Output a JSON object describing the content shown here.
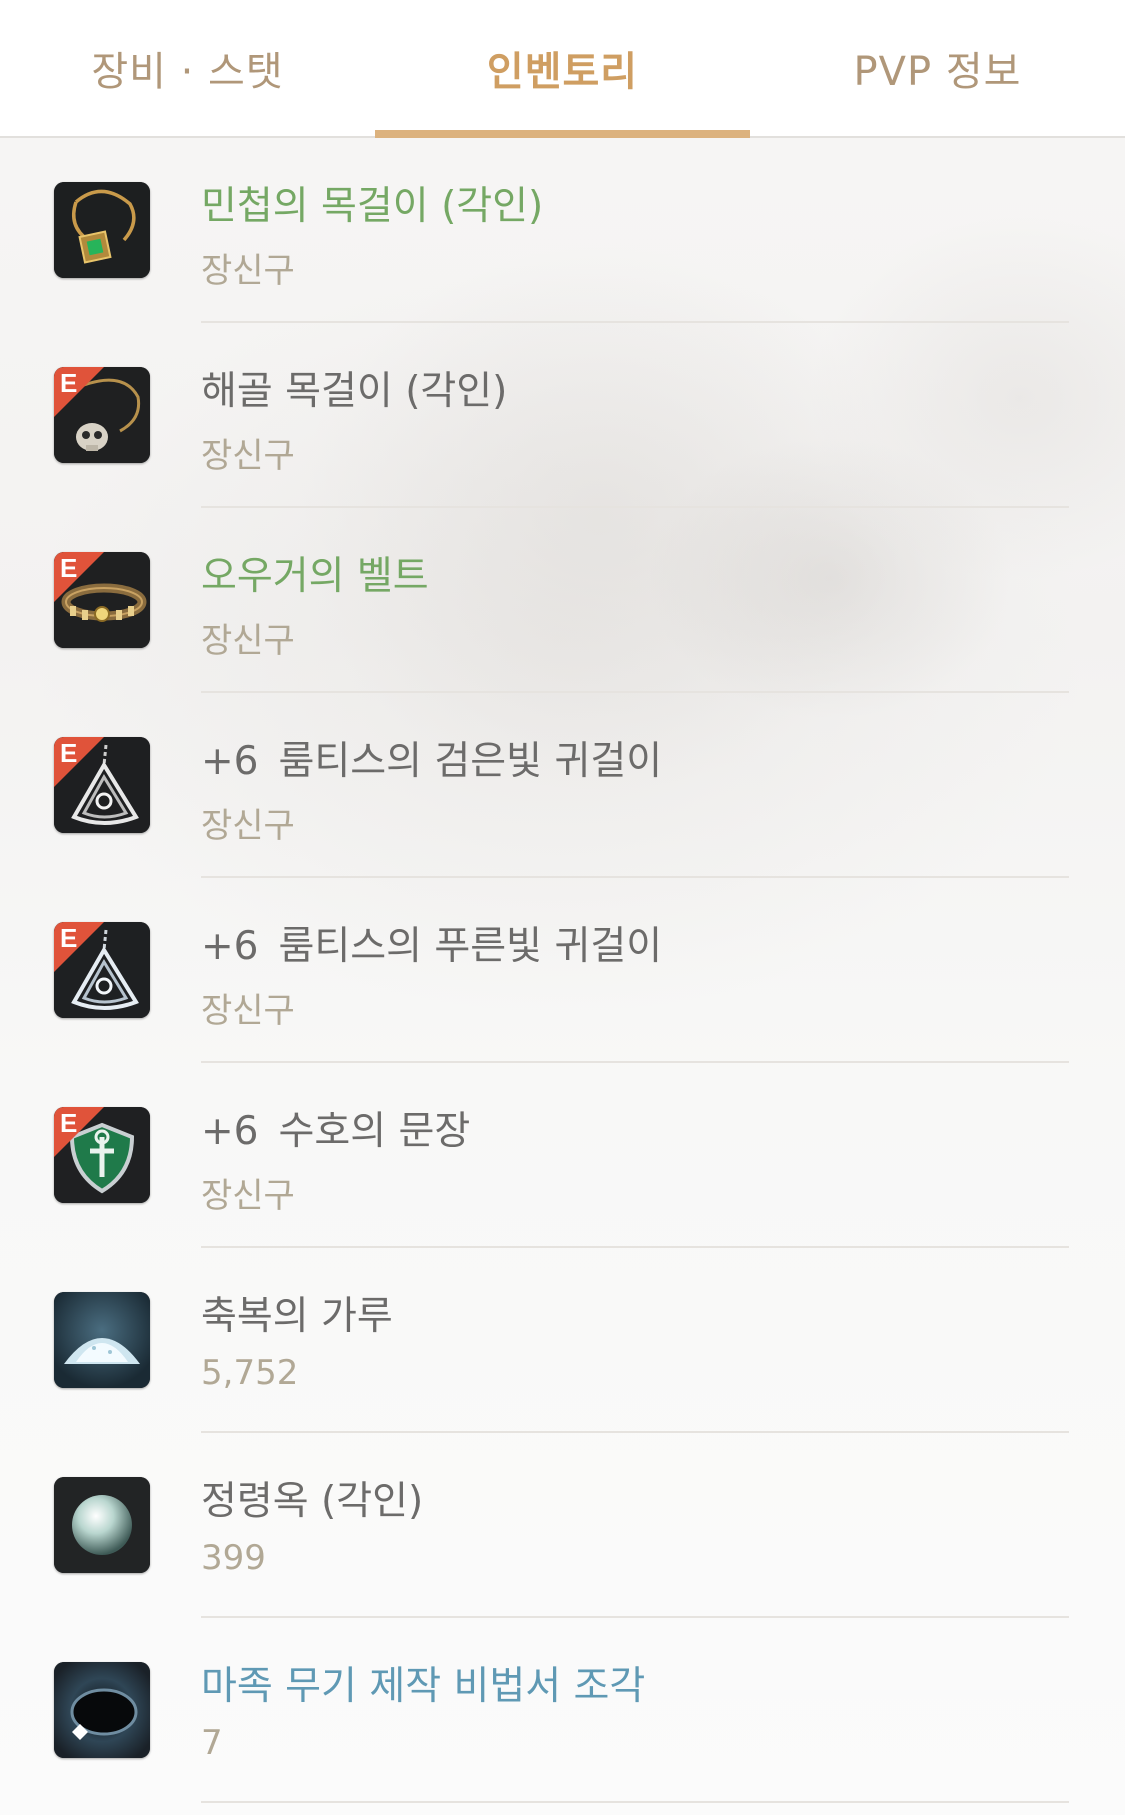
{
  "tabs": [
    {
      "label": "장비 · 스탯",
      "active": false
    },
    {
      "label": "인벤토리",
      "active": true
    },
    {
      "label": "PVP 정보",
      "active": false
    }
  ],
  "colors": {
    "tab_active": "#cf9e62",
    "tab_inactive": "#b09779",
    "name_green": "#75a864",
    "name_blue": "#5f99b4",
    "name_default": "#6c6b6a",
    "sub_text": "#b1a895",
    "e_badge": "#e0533a"
  },
  "items": [
    {
      "prefix": "",
      "name": "민첩의 목걸이 (각인)",
      "sub": "장신구",
      "name_color": "green",
      "badge": "",
      "icon": "emerald-necklace-icon"
    },
    {
      "prefix": "",
      "name": "해골 목걸이 (각인)",
      "sub": "장신구",
      "name_color": "default",
      "badge": "E",
      "icon": "skull-necklace-icon"
    },
    {
      "prefix": "",
      "name": "오우거의 벨트",
      "sub": "장신구",
      "name_color": "green",
      "badge": "E",
      "icon": "belt-icon"
    },
    {
      "prefix": "+6",
      "name": "룸티스의 검은빛 귀걸이",
      "sub": "장신구",
      "name_color": "default",
      "badge": "E",
      "icon": "earring-icon"
    },
    {
      "prefix": "+6",
      "name": "룸티스의 푸른빛 귀걸이",
      "sub": "장신구",
      "name_color": "default",
      "badge": "E",
      "icon": "earring-icon"
    },
    {
      "prefix": "+6",
      "name": "수호의 문장",
      "sub": "장신구",
      "name_color": "default",
      "badge": "E",
      "icon": "emblem-icon"
    },
    {
      "prefix": "",
      "name": "축복의 가루",
      "sub": "5,752",
      "name_color": "default",
      "badge": "",
      "icon": "powder-icon"
    },
    {
      "prefix": "",
      "name": "정령옥 (각인)",
      "sub": "399",
      "name_color": "default",
      "badge": "",
      "icon": "pearl-icon"
    },
    {
      "prefix": "",
      "name": "마족 무기 제작 비법서 조각",
      "sub": "7",
      "name_color": "blue",
      "badge": "",
      "icon": "scroll-fragment-icon"
    }
  ]
}
